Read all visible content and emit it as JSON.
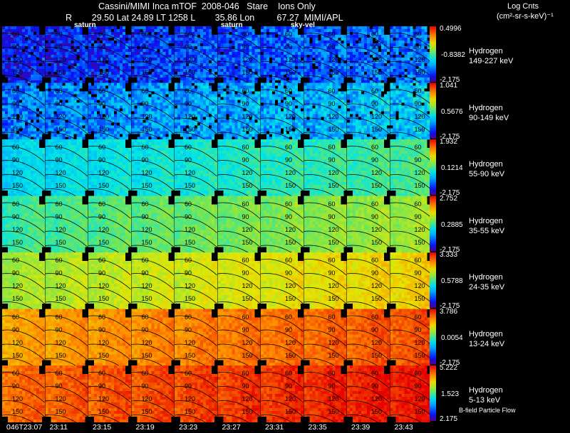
{
  "header": {
    "line1": "Cassini/MIMI Inca mTOF  2008-046   Stare    Ions Only",
    "line2": "R        29.50 Lat 24.89 LT 1258 L        35.86 Lon         67.27  MIMI/APL",
    "units_line1": "Log Cnts",
    "units_line2": "(cm²-sr-s-keV)⁻¹"
  },
  "markers": {
    "saturn": "saturn",
    "skyvel": "sky-vel"
  },
  "contour_labels": [
    "60",
    "90",
    "120",
    "150"
  ],
  "rows": [
    {
      "species": "Hydrogen",
      "energy": "149-227 keV",
      "cb_max": "0.4996",
      "cb_mid": "-0.8382",
      "cb_min": "-2.175",
      "level": 0.1
    },
    {
      "species": "Hydrogen",
      "energy": "90-149 keV",
      "cb_max": "1.041",
      "cb_mid": "0.5676",
      "cb_min": "-2.175",
      "level": 0.22
    },
    {
      "species": "Hydrogen",
      "energy": "55-90 keV",
      "cb_max": "1.932",
      "cb_mid": "0.1214",
      "cb_min": "-2.175",
      "level": 0.36
    },
    {
      "species": "Hydrogen",
      "energy": "35-55 keV",
      "cb_max": "2.752",
      "cb_mid": "0.2885",
      "cb_min": "-2.175",
      "level": 0.46
    },
    {
      "species": "Hydrogen",
      "energy": "24-35 keV",
      "cb_max": "3.333",
      "cb_mid": "0.5788",
      "cb_min": "-2.175",
      "level": 0.58
    },
    {
      "species": "Hydrogen",
      "energy": "13-24 keV",
      "cb_max": "3.786",
      "cb_mid": "0.0054",
      "cb_min": "-2.175",
      "level": 0.76
    },
    {
      "species": "Hydrogen",
      "energy": "5-13 keV",
      "cb_max": "5.222",
      "cb_mid": "1.523",
      "cb_min": "2.175",
      "level": 0.84
    }
  ],
  "times": [
    "046T23:07",
    "23:11",
    "23:15",
    "23:19",
    "23:23",
    "23:27",
    "23:31",
    "23:35",
    "23:39",
    "23:43"
  ],
  "flow_label": "B-field Particle Flow"
}
